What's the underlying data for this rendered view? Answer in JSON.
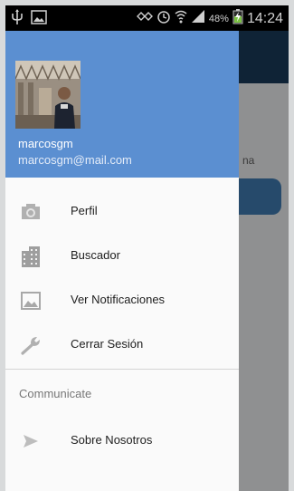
{
  "status_bar": {
    "battery_percent": "48%",
    "time": "14:24"
  },
  "drawer": {
    "user": {
      "name": "marcosgm",
      "email": "marcosgm@mail.com"
    },
    "items": [
      {
        "label": "Perfil",
        "icon": "camera-icon"
      },
      {
        "label": "Buscador",
        "icon": "building-icon"
      },
      {
        "label": "Ver Notificaciones",
        "icon": "image-icon"
      },
      {
        "label": "Cerrar Sesión",
        "icon": "wrench-icon"
      }
    ],
    "section": {
      "title": "Communicate",
      "items": [
        {
          "label": "Sobre Nosotros",
          "icon": "send-icon"
        }
      ]
    }
  },
  "background_app": {
    "partial_text": "na"
  },
  "colors": {
    "drawer_header": "#5b8fd1",
    "toolbar": "#0f2336",
    "overlay": "#8f9091"
  }
}
